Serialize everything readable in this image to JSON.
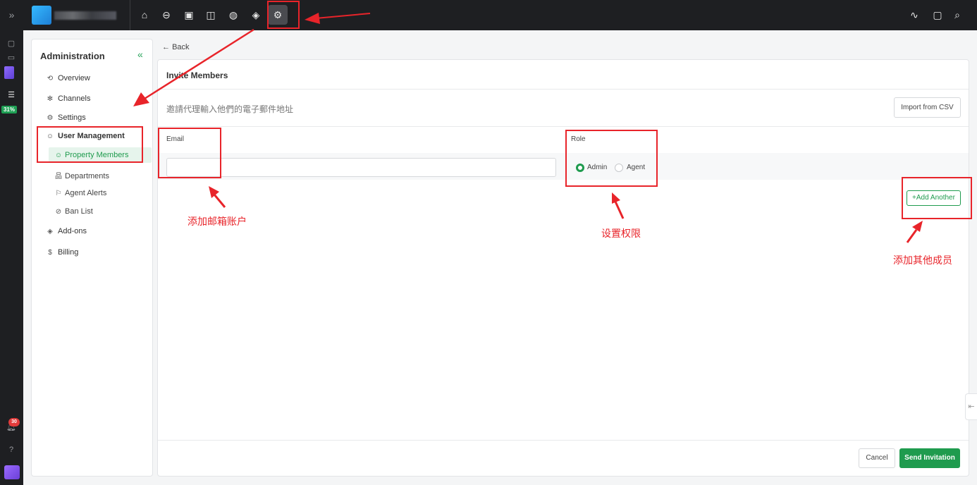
{
  "rail": {
    "expand_icon": "double-chevron-right-icon",
    "progress_percent": "31%",
    "notification_count": "30"
  },
  "topbar": {
    "nav_icons": [
      "home-icon",
      "inbox-icon",
      "contacts-icon",
      "knowledge-book-icon",
      "reports-icon",
      "cube-icon",
      "settings-gear-icon"
    ],
    "right_icons": [
      "activity-icon",
      "chat-icon",
      "search-icon"
    ]
  },
  "sidebar": {
    "title": "Administration",
    "collapse_glyph": "«",
    "items": {
      "overview": "Overview",
      "channels": "Channels",
      "settings": "Settings",
      "user_management": "User Management",
      "property_members": "Property Members",
      "departments": "Departments",
      "agent_alerts": "Agent Alerts",
      "ban_list": "Ban List",
      "addons": "Add-ons",
      "billing": "Billing"
    }
  },
  "back_label": "Back",
  "invite": {
    "title": "Invite Members",
    "subtitle": "邀請代理輸入他們的電子郵件地址",
    "import_button": "Import from CSV",
    "email_header": "Email",
    "role_header": "Role",
    "email_value": "",
    "role_options": [
      "Admin",
      "Agent"
    ],
    "selected_role": "Admin",
    "add_another": "Add Another",
    "cancel": "Cancel",
    "send": "Send Invitation"
  },
  "annotations": {
    "email": "添加邮箱账户",
    "role": "设置权限",
    "add": "添加其他成员"
  },
  "colors": {
    "accent_green": "#1f9b4e",
    "annotation_red": "#e8242a",
    "topbar_dark": "#1e1f22"
  }
}
